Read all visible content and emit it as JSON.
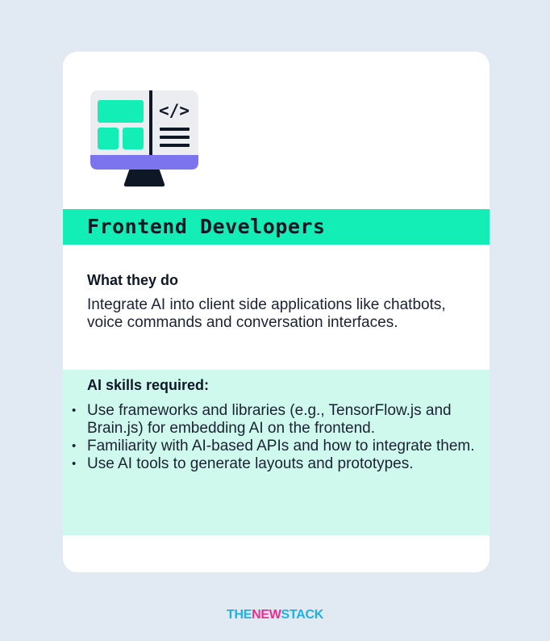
{
  "card": {
    "title": "Frontend Developers",
    "what_heading": "What they do",
    "what_body": "Integrate AI into client side applications like chatbots, voice commands and conversation interfaces.",
    "skills_heading": "AI skills required:",
    "skills": [
      "Use frameworks and libraries (e.g., TensorFlow.js and Brain.js) for embedding AI on the frontend.",
      "Familiarity with AI-based APIs and how to integrate them.",
      "Use AI tools to generate layouts and prototypes."
    ],
    "bullet": "•"
  },
  "icon": {
    "name": "monitor-code-icon",
    "code_glyph": "</>"
  },
  "brand": {
    "part1": "THE",
    "part2": "NEW",
    "part3": "STACK"
  },
  "colors": {
    "background": "#e1e9f3",
    "accent_green": "#13eeb6",
    "light_green": "#d0f9ee",
    "monitor_base": "#7b74ee",
    "monitor_stand": "#0e1726",
    "brand_blue": "#1fb0e6",
    "brand_pink": "#ef2d8e"
  }
}
